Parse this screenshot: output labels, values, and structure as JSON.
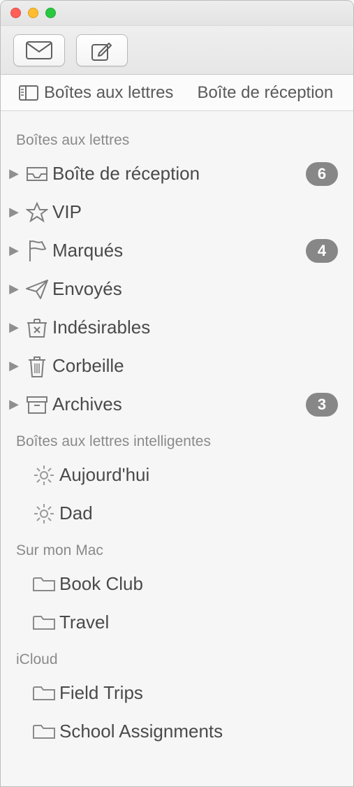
{
  "favorites": {
    "mailboxes": "Boîtes aux lettres",
    "inbox": "Boîte de réception"
  },
  "sections": {
    "mailboxes": {
      "title": "Boîtes aux lettres",
      "items": {
        "inbox": {
          "label": "Boîte de réception",
          "badge": "6"
        },
        "vip": {
          "label": "VIP"
        },
        "flagged": {
          "label": "Marqués",
          "badge": "4"
        },
        "sent": {
          "label": "Envoyés"
        },
        "junk": {
          "label": "Indésirables"
        },
        "trash": {
          "label": "Corbeille"
        },
        "archive": {
          "label": "Archives",
          "badge": "3"
        }
      }
    },
    "smart": {
      "title": "Boîtes aux lettres intelligentes",
      "items": {
        "today": {
          "label": "Aujourd'hui"
        },
        "dad": {
          "label": "Dad"
        }
      }
    },
    "onmymac": {
      "title": "Sur mon Mac",
      "items": {
        "bookclub": {
          "label": "Book Club"
        },
        "travel": {
          "label": "Travel"
        }
      }
    },
    "icloud": {
      "title": "iCloud",
      "items": {
        "fieldtrips": {
          "label": "Field Trips"
        },
        "assignments": {
          "label": "School Assignments"
        }
      }
    }
  }
}
